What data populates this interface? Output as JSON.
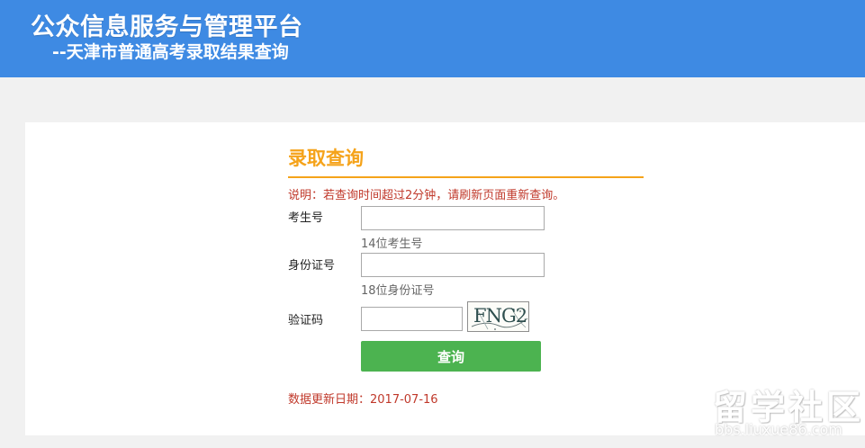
{
  "header": {
    "title": "公众信息服务与管理平台",
    "subtitle": "--天津市普通高考录取结果查询"
  },
  "form": {
    "title": "录取查询",
    "note": "说明：若查询时间超过2分钟，请刷新页面重新查询。",
    "exam_number": {
      "label": "考生号",
      "value": "",
      "hint": "14位考生号"
    },
    "id_number": {
      "label": "身份证号",
      "value": "",
      "hint": "18位身份证号"
    },
    "captcha": {
      "label": "验证码",
      "value": "",
      "image_text": "FNG2"
    },
    "submit_label": "查询",
    "update_text": "数据更新日期：2017-07-16"
  },
  "watermark": {
    "main": "留学社区",
    "url": "bbs.liuxue86.com"
  },
  "colors": {
    "header_bg": "#3e8ae3",
    "accent": "#f5a31a",
    "alert_text": "#c0392b",
    "button_bg": "#4cb350"
  }
}
